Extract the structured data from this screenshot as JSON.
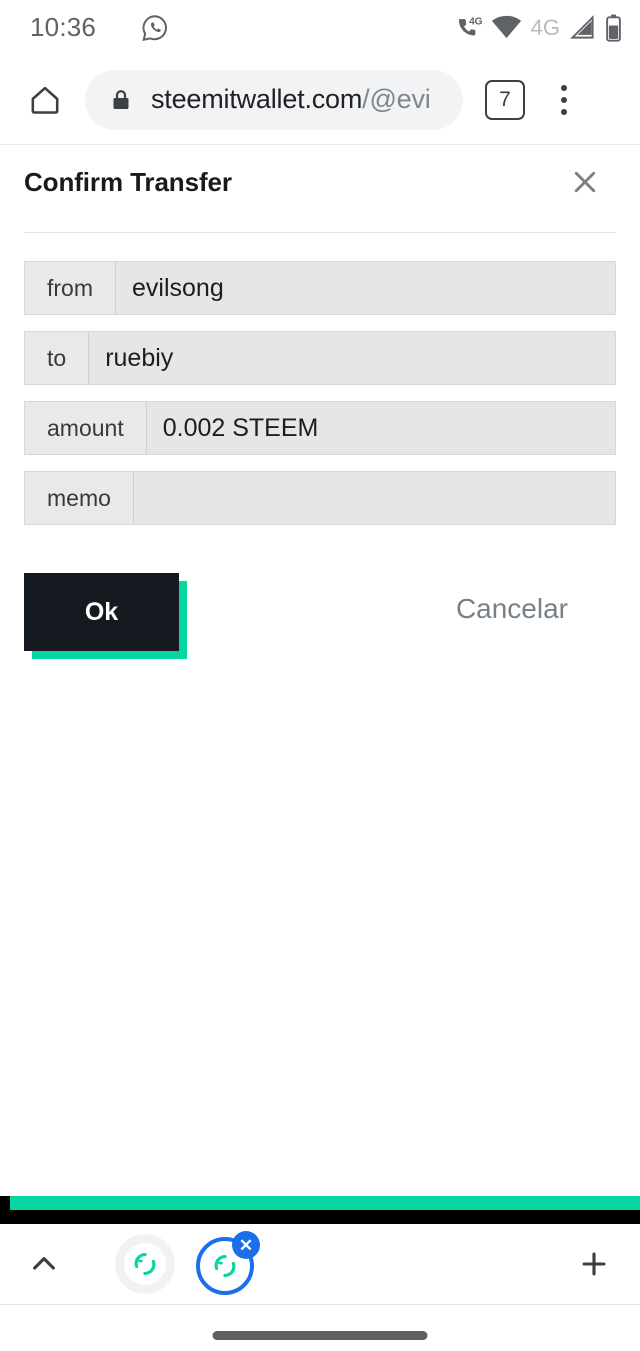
{
  "status_bar": {
    "time": "10:36",
    "icons": [
      {
        "name": "whatsapp-icon"
      },
      {
        "name": "volte-4g-icon",
        "label": "4G"
      },
      {
        "name": "wifi-icon"
      },
      {
        "name": "mobile-data-4g-label",
        "label": "4G"
      },
      {
        "name": "cell-signal-icon"
      },
      {
        "name": "battery-icon"
      }
    ]
  },
  "browser": {
    "home_icon": "home-icon",
    "lock_icon": "lock-icon",
    "url_main": "steemitwallet.com",
    "url_path": "/@evi",
    "tab_count": "7",
    "menu_icon": "three-dot-menu-icon"
  },
  "dialog": {
    "title": "Confirm Transfer",
    "close_icon": "close-icon",
    "fields": [
      {
        "label": "from",
        "value": "evilsong"
      },
      {
        "label": "to",
        "value": "ruebiy"
      },
      {
        "label": "amount",
        "value": "0.002 STEEM"
      },
      {
        "label": "memo",
        "value": ""
      }
    ],
    "ok_label": "Ok",
    "cancel_label": "Cancelar"
  },
  "bottom_toolbar": {
    "chevron_icon": "chevron-up-icon",
    "app_icon_1": "steem-logo-icon",
    "app_icon_2": "steem-logo-icon",
    "close_badge_label": "✕",
    "plus_icon": "plus-icon"
  },
  "colors": {
    "accent_teal": "#06d6a0",
    "dark_button": "#141a20",
    "blue_ring": "#1c6fea",
    "cancel_gray": "#77818a"
  }
}
